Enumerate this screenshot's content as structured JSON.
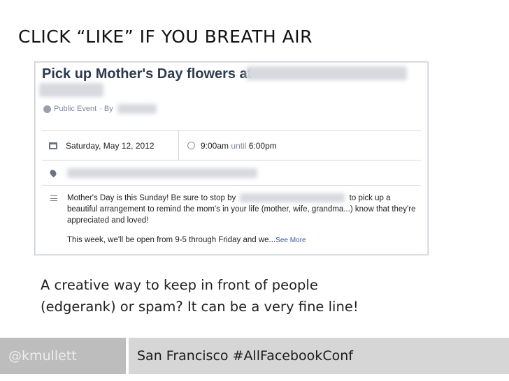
{
  "slide": {
    "title": "CLICK “LIKE” IF YOU BREATH AIR",
    "caption_line1": "A creative way to keep in front of people",
    "caption_line2": "(edgerank) or spam? It can be a very fine line!"
  },
  "event": {
    "title": "Pick up Mother's Day flowers at",
    "meta_type": "Public Event",
    "meta_by": "· By",
    "date": "Saturday, May 12, 2012",
    "time_start": "9:00am",
    "time_until": "until",
    "time_end": "6:00pm",
    "desc_part1": "Mother's Day is this Sunday! Be sure to stop by",
    "desc_part2": "to pick up a beautiful arrangement to remind the mom's in your life (mother, wife, grandma...) know that they're appreciated and loved!",
    "desc_line2": "This week, we'll be open from 9-5 through Friday and we...",
    "see_more": "See More"
  },
  "footer": {
    "handle": "@kmullett",
    "event": "San Francisco #AllFacebookConf"
  },
  "colors": {
    "fb_title": "#2e3a4f",
    "fb_link": "#3b5998",
    "footer_left_bg": "#bdbdbd",
    "footer_right_bg": "#d6d6d6"
  }
}
